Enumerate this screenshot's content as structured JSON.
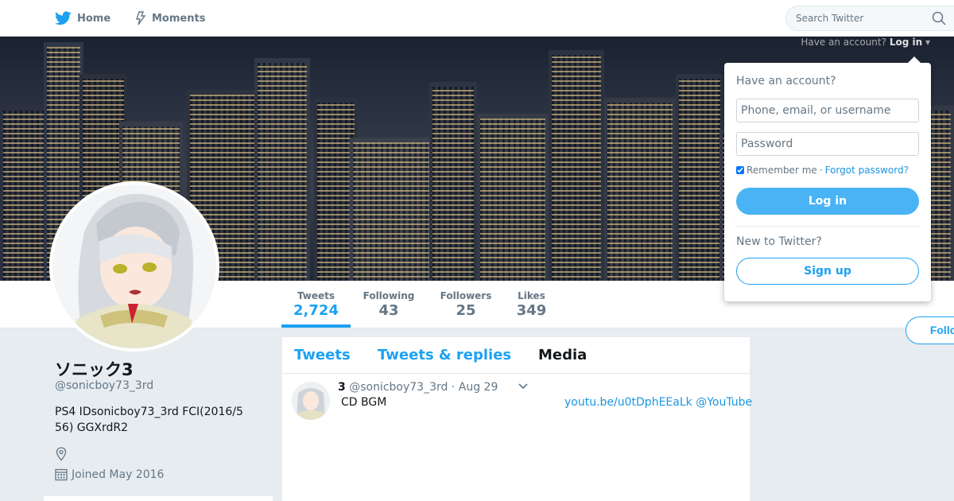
{
  "colors": {
    "accent": "#1da1f2",
    "link": "#1b95e0",
    "login_button": "#4ab3f4",
    "muted": "#657786",
    "background": "#e6ecf0"
  },
  "nav": {
    "home_label": "Home",
    "home_icon": "twitter-bird-icon",
    "moments_label": "Moments",
    "moments_icon": "lightning-icon",
    "search_placeholder": "Search Twitter",
    "search_icon": "search-icon"
  },
  "login_hint": {
    "text": "Have an account?",
    "link": "Log in"
  },
  "stats": [
    {
      "label": "Tweets",
      "value": "2,724",
      "active": true
    },
    {
      "label": "Following",
      "value": "43"
    },
    {
      "label": "Followers",
      "value": "25"
    },
    {
      "label": "Likes",
      "value": "349"
    }
  ],
  "follow_label": "Follow",
  "profile": {
    "name": "ソニック3",
    "handle": "@sonicboy73_3rd",
    "bio": "PS4 IDsonicboy73_3rd FCI(2016/5\n 56) GGXrdR2",
    "location_icon": "location-pin-icon",
    "joined_icon": "calendar-icon",
    "joined": "Joined May 2016"
  },
  "timeline": {
    "tabs": [
      {
        "label": "Tweets"
      },
      {
        "label": "Tweets & replies"
      },
      {
        "label": "Media",
        "active": true
      }
    ],
    "tweets": [
      {
        "name": "3",
        "handle": "@sonicboy73_3rd",
        "date": "· Aug 29",
        "text": "CD BGM",
        "link": "youtu.be/u0tDphEEaLk @YouTube"
      }
    ]
  },
  "login_dropdown": {
    "title": "Have an account?",
    "username_placeholder": "Phone, email, or username",
    "password_placeholder": "Password",
    "remember_label": "Remember me",
    "separator": "·",
    "forgot_label": "Forgot password?",
    "login_label": "Log in",
    "new_label": "New to Twitter?",
    "signup_label": "Sign up"
  }
}
